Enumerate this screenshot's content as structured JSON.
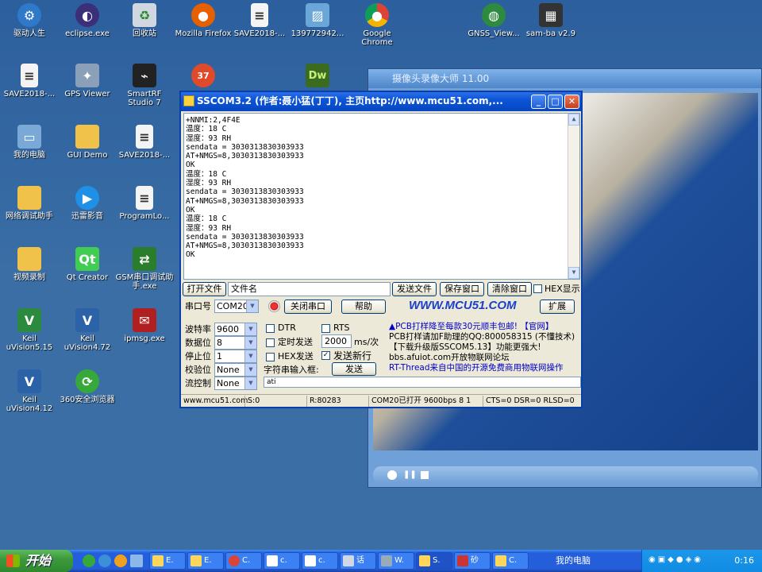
{
  "desktop": {
    "icons": [
      {
        "label": "驱动人生",
        "icon": "gear-icon",
        "color": "#2e79c9"
      },
      {
        "label": "eclipse.exe",
        "icon": "eclipse-icon",
        "color": "#3b2f7a"
      },
      {
        "label": "回收站",
        "icon": "recycle-bin-icon",
        "color": "#cfd8e0"
      },
      {
        "label": "Mozilla Firefox",
        "icon": "firefox-icon",
        "color": "#e66000"
      },
      {
        "label": "SAVE2018-...",
        "icon": "document-icon",
        "color": "#f4f4f4"
      },
      {
        "label": "139772942...",
        "icon": "image-file-icon",
        "color": "#6aa6d8"
      },
      {
        "label": "Google Chrome",
        "icon": "chrome-icon",
        "color": "#db4437"
      },
      {
        "label": "GNSS_View...",
        "icon": "globe-icon",
        "color": "#2d8a3e"
      },
      {
        "label": "sam-ba v2.9",
        "icon": "chip-icon",
        "color": "#333333"
      },
      {
        "label": "SAVE2018-...",
        "icon": "document-icon",
        "color": "#f4f4f4"
      },
      {
        "label": "GPS Viewer",
        "icon": "satellite-icon",
        "color": "#8aa0b8"
      },
      {
        "label": "SmartRF Studio 7",
        "icon": "rf-icon",
        "color": "#222222"
      },
      {
        "label": "37",
        "icon": "360-browser-badge-icon",
        "color": "#e04a2a"
      },
      {
        "label": "Dw",
        "icon": "dreamweaver-icon",
        "color": "#3a6b1e"
      },
      {
        "label": "我的电脑",
        "icon": "computer-icon",
        "color": "#7aa9d8"
      },
      {
        "label": "GUI Demo",
        "icon": "folder-icon",
        "color": "#f0c24a"
      },
      {
        "label": "SAVE2018-...",
        "icon": "document-icon",
        "color": "#f4f4f4"
      },
      {
        "label": "网络调试助手",
        "icon": "folder-icon",
        "color": "#f0c24a"
      },
      {
        "label": "迅雷影音",
        "icon": "player-icon",
        "color": "#1e90e6"
      },
      {
        "label": "ProgramLo...",
        "icon": "document-icon",
        "color": "#f4f4f4"
      },
      {
        "label": "视频录制",
        "icon": "folder-icon",
        "color": "#f0c24a"
      },
      {
        "label": "Qt Creator",
        "icon": "qt-icon",
        "color": "#41cd52"
      },
      {
        "label": "GSM串口调试助手.exe",
        "icon": "network-icon",
        "color": "#2a7d2a"
      },
      {
        "label": "Keil uVision5.15",
        "icon": "keil-icon",
        "color": "#2b8a3e"
      },
      {
        "label": "Keil uVision4.72",
        "icon": "keil-icon",
        "color": "#2b62a8"
      },
      {
        "label": "ipmsg.exe",
        "icon": "ipmsg-icon",
        "color": "#b02020"
      },
      {
        "label": "Keil uVision4.12",
        "icon": "keil-icon",
        "color": "#2b62a8"
      },
      {
        "label": "360安全浏览器",
        "icon": "360-browser-icon",
        "color": "#37a93b"
      }
    ]
  },
  "video_window": {
    "title": "摄像头录像大师 11.00"
  },
  "sscom": {
    "title": "SSCOM3.2 (作者:聂小猛(丁丁), 主页http://www.mcu51.com,...",
    "receive_lines": [
      "+NNMI:2,4F4E",
      "温度：18 C",
      "湿度：93 RH",
      "sendata = 3030313830303933",
      "AT+NMGS=8,3030313830303933",
      "OK",
      "温度：18 C",
      "湿度：93 RH",
      "sendata = 3030313830303933",
      "AT+NMGS=8,3030313830303933",
      "OK",
      "温度：18 C",
      "湿度：93 RH",
      "sendata = 3030313830303933",
      "AT+NMGS=8,3030313830303933",
      "OK"
    ],
    "open_file_label": "打开文件",
    "filename_value": "文件名",
    "send_file_label": "发送文件",
    "save_window_label": "保存窗口",
    "clear_window_label": "清除窗口",
    "hex_display_label": "HEX显示",
    "port_label": "串口号",
    "port_value": "COM20",
    "close_port_label": "关闭串口",
    "help_label": "帮助",
    "brand": "WWW.MCU51.COM",
    "expand_label": "扩展",
    "baud_label": "波特率",
    "baud_value": "9600",
    "databits_label": "数据位",
    "databits_value": "8",
    "stopbits_label": "停止位",
    "stopbits_value": "1",
    "parity_label": "校验位",
    "parity_value": "None",
    "flow_label": "流控制",
    "flow_value": "None",
    "dtr_label": "DTR",
    "rts_label": "RTS",
    "timed_send_label": "定时发送",
    "interval_value": "2000",
    "interval_unit": "ms/次",
    "hex_send_label": "HEX发送",
    "send_newline_label": "发送新行",
    "input_label": "字符串输入框:",
    "send_label": "发送",
    "input_value": "ati",
    "ad_lines": [
      "▲PCB打样降至每款30元顺丰包邮! 【官网】",
      "PCB打样请加F助理的QQ:800058315 (不懂技术)",
      "【下载升级版SSCOM5.13】功能更强大!",
      "bbs.afuiot.com开放物联网论坛",
      "RT-Thread来自中国的开源免费商用物联网操作"
    ],
    "status": {
      "site": "www.mcu51.com",
      "sent": "S:0",
      "received": "R:80283",
      "port_state": "COM20已打开  9600bps  8  1",
      "lines": "CTS=0 DSR=0 RLSD=0"
    }
  },
  "taskbar": {
    "start_label": "开始",
    "tasks": [
      "E.",
      "E.",
      "C.",
      "c.",
      "c.",
      "话",
      "W.",
      "S.",
      "砂",
      "C."
    ],
    "tray_label": "我的电脑",
    "clock": "0:16"
  },
  "colors": {
    "desktop": "#3a6ea5",
    "title_bar": "#0a55d8",
    "brand": "#1a3fd0",
    "ad_blue": "#0000c8",
    "ad_red": "#d00000"
  }
}
